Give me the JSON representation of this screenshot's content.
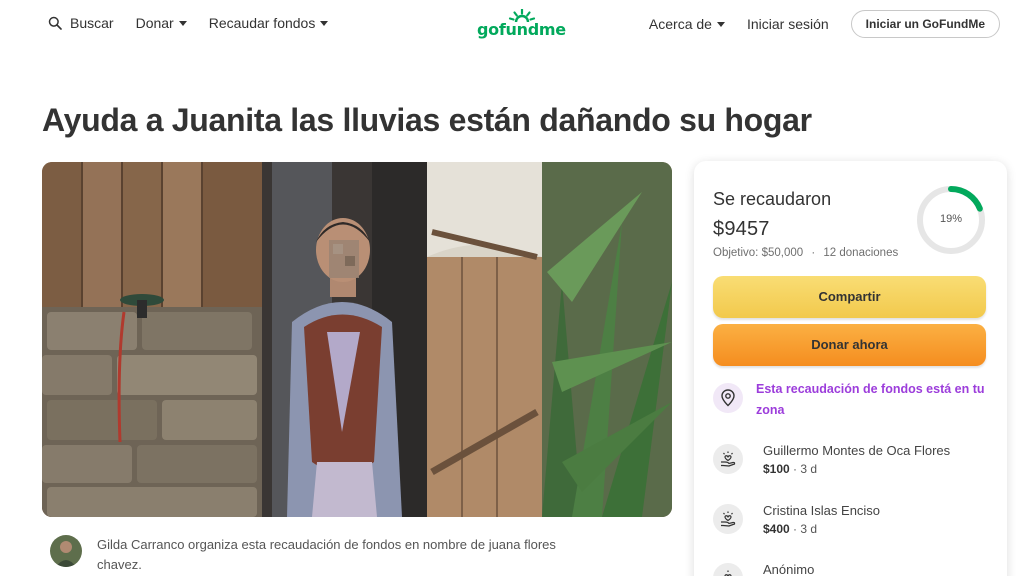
{
  "header": {
    "search_label": "Buscar",
    "donate_label": "Donar",
    "fundraise_label": "Recaudar fondos",
    "logo_text": "gofundme",
    "about_label": "Acerca de",
    "login_label": "Iniciar sesión",
    "start_button_label": "Iniciar un GoFundMe"
  },
  "campaign": {
    "title": "Ayuda a Juanita las lluvias están dañando su hogar",
    "organizer_text": "Gilda Carranco organiza esta recaudación de fondos en nombre de juana flores chavez."
  },
  "donation_card": {
    "raised_label": "Se recaudaron",
    "raised_amount": "$9457",
    "goal_text": "Objetivo: $50,000",
    "separator": "·",
    "donations_count_text": "12 donaciones",
    "progress_text": "19%",
    "progress_fraction": 0.19,
    "share_label": "Compartir",
    "donate_now_label": "Donar ahora",
    "zone_notice": "Esta recaudación de fondos está en tu zona",
    "donors": [
      {
        "name": "Guillermo Montes de Oca Flores",
        "amount": "$100",
        "time": "· 3 d"
      },
      {
        "name": "Cristina Islas Enciso",
        "amount": "$400",
        "time": "· 3 d"
      },
      {
        "name": "Anónimo",
        "amount": "",
        "time": ""
      }
    ]
  },
  "colors": {
    "brand_green": "#02a95c",
    "share_yellow": "#f2c94c",
    "donate_orange": "#f58d1f",
    "zone_purple": "#9c3ddb"
  },
  "icons": {
    "search": "search-icon",
    "caret": "chevron-down-icon",
    "location": "location-pin-icon",
    "donor": "heart-hand-icon"
  }
}
